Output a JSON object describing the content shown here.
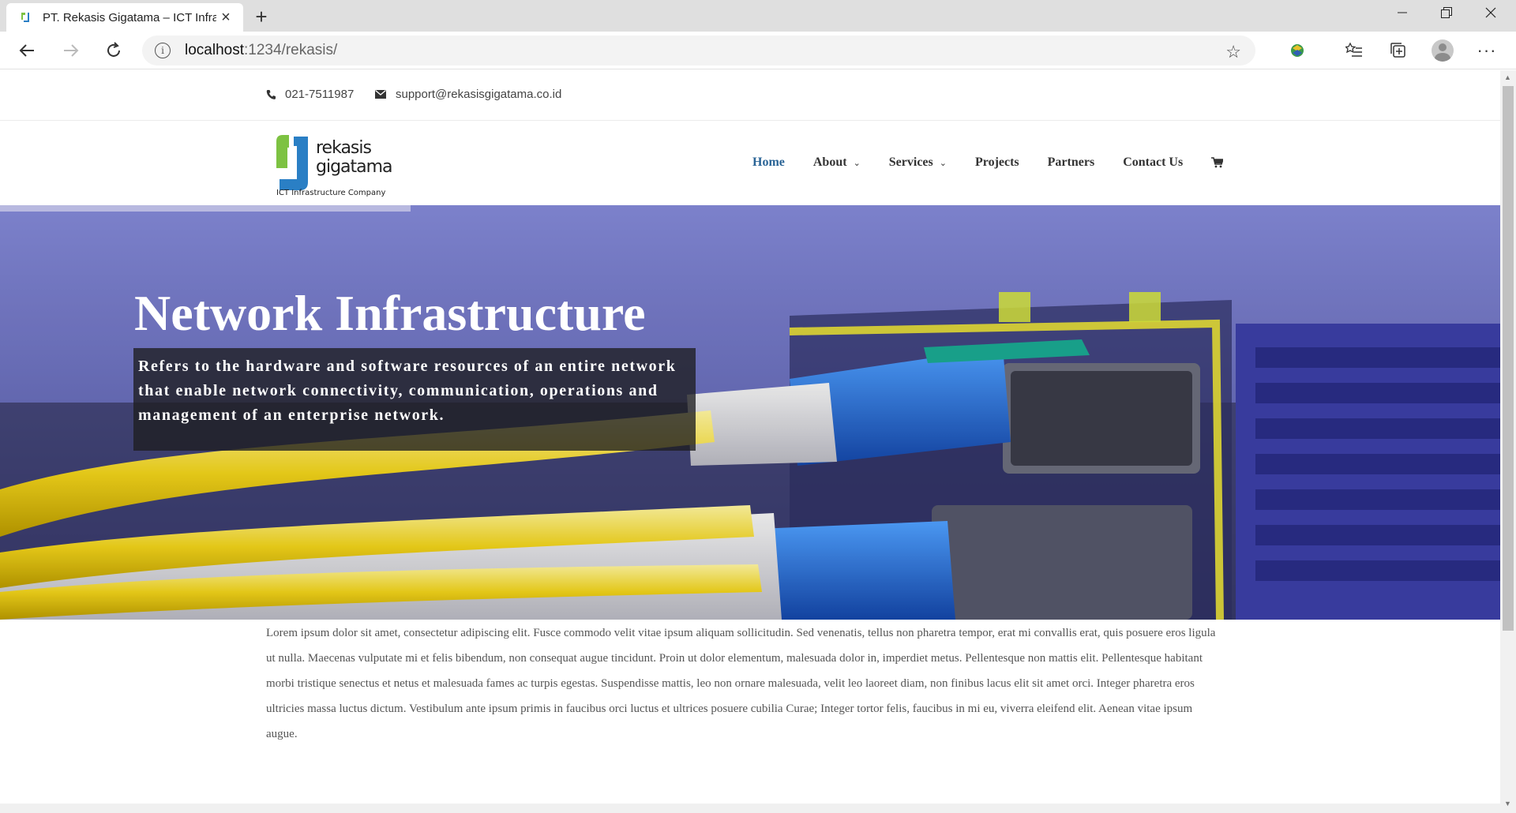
{
  "browser": {
    "tab_title": "PT. Rekasis Gigatama – ICT Infrastructure Company",
    "url_host": "localhost",
    "url_path": ":1234/rekasis/",
    "tab_close": "×",
    "new_tab": "+"
  },
  "topbar": {
    "phone": "021-7511987",
    "email": "support@rekasisgigatama.co.id"
  },
  "logo": {
    "line1": "rekasis",
    "line2": "gigatama",
    "tagline": "ICT Infrastructure Company",
    "colors": {
      "green": "#7dc242",
      "blue": "#2a7fc5"
    }
  },
  "nav": {
    "items": [
      {
        "label": "Home",
        "active": true
      },
      {
        "label": "About",
        "dropdown": true
      },
      {
        "label": "Services",
        "dropdown": true
      },
      {
        "label": "Projects"
      },
      {
        "label": "Partners"
      },
      {
        "label": "Contact Us"
      }
    ],
    "cart_icon": "cart-icon",
    "chevron": "⌄"
  },
  "hero": {
    "title": "Network Infrastructure",
    "description": "Refers to the hardware and software resources of an entire network that enable network connectivity, communication, operations and management of an enterprise network."
  },
  "content": {
    "paragraph": "Lorem ipsum dolor sit amet, consectetur adipiscing elit. Fusce commodo velit vitae ipsum aliquam sollicitudin. Sed venenatis, tellus non pharetra tempor, erat mi convallis erat, quis posuere eros ligula ut nulla. Maecenas vulputate mi et felis bibendum, non consequat augue tincidunt. Proin ut dolor elementum, malesuada dolor in, imperdiet metus. Pellentesque non mattis elit. Pellentesque habitant morbi tristique senectus et netus et malesuada fames ac turpis egestas. Suspendisse mattis, leo non ornare malesuada, velit leo laoreet diam, non finibus lacus elit sit amet orci. Integer pharetra eros ultricies massa luctus dictum. Vestibulum ante ipsum primis in faucibus orci luctus et ultrices posuere cubilia Curae; Integer tortor felis, faucibus in mi eu, viverra eleifend elit. Aenean vitae ipsum augue."
  },
  "colors": {
    "accent": "#2a6496",
    "text": "#333333"
  }
}
